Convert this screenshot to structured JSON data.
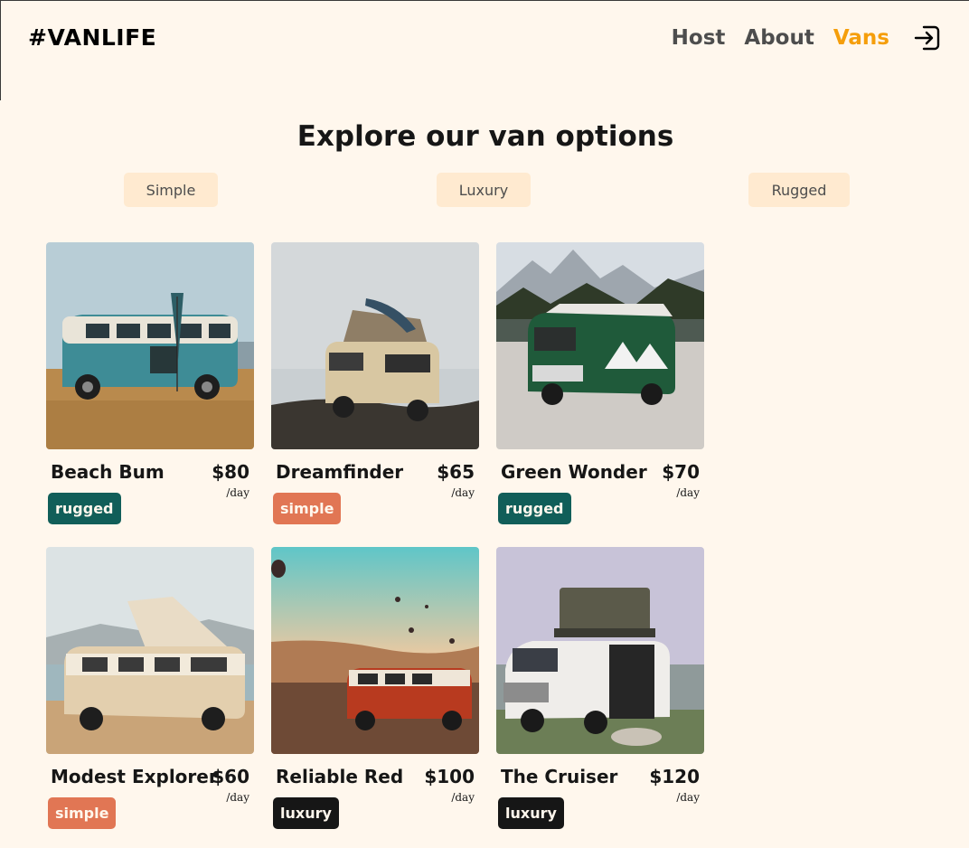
{
  "header": {
    "logo": "#VANLIFE",
    "nav": [
      {
        "label": "Host",
        "active": false
      },
      {
        "label": "About",
        "active": false
      },
      {
        "label": "Vans",
        "active": true
      }
    ],
    "login_icon": "login-icon"
  },
  "main": {
    "title": "Explore our van options",
    "filters": [
      "Simple",
      "Luxury",
      "Rugged"
    ],
    "per_day": "/day",
    "vans": [
      {
        "name": "Beach Bum",
        "price": "$80",
        "type": "rugged",
        "van_color": "#3E8C96"
      },
      {
        "name": "Dreamfinder",
        "price": "$65",
        "type": "simple",
        "van_color": "#D8C7A2"
      },
      {
        "name": "Green Wonder",
        "price": "$70",
        "type": "rugged",
        "van_color": "#1F5A3A"
      },
      {
        "name": "Modest Explorer",
        "price": "$60",
        "type": "simple",
        "van_color": "#E3CFAE"
      },
      {
        "name": "Reliable Red",
        "price": "$100",
        "type": "luxury",
        "van_color": "#B83A1F"
      },
      {
        "name": "The Cruiser",
        "price": "$120",
        "type": "luxury",
        "van_color": "#EFEDEA"
      }
    ]
  },
  "colors": {
    "background": "#FFF7ED",
    "accent": "#F59E0B",
    "filter_bg": "#FFEAD0",
    "simple": "#E17654",
    "rugged": "#115E59",
    "luxury": "#161616"
  }
}
